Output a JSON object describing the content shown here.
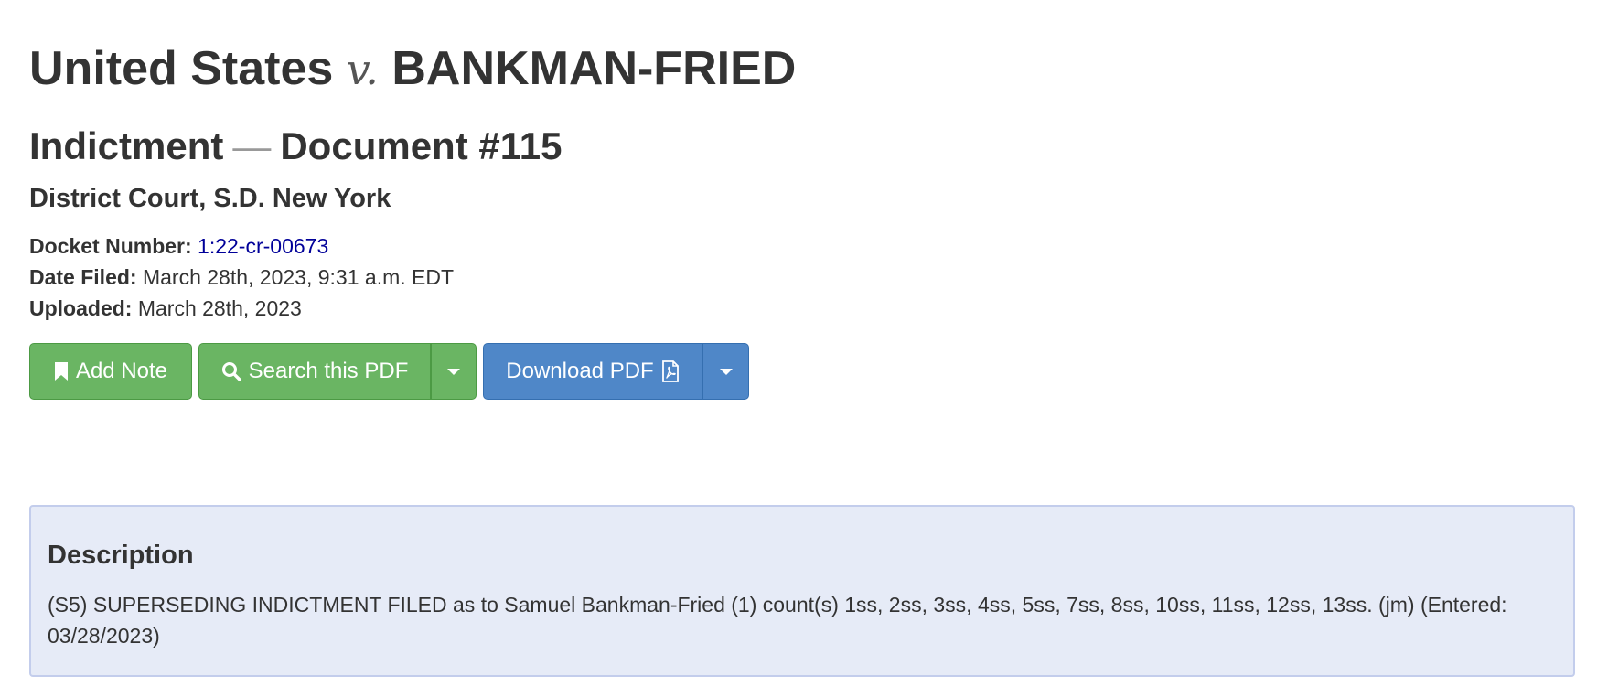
{
  "case": {
    "plaintiff": "United States",
    "versus": "v.",
    "defendant": "BANKMAN-FRIED"
  },
  "document": {
    "type": "Indictment",
    "separator": "—",
    "number": "Document #115"
  },
  "court": "District Court, S.D. New York",
  "meta": {
    "docket_label": "Docket Number:",
    "docket_value": "1:22-cr-00673",
    "filed_label": "Date Filed:",
    "filed_value": "March 28th, 2023, 9:31 a.m. EDT",
    "uploaded_label": "Uploaded:",
    "uploaded_value": "March 28th, 2023"
  },
  "actions": {
    "add_note": {
      "label": "Add Note",
      "icon": "bookmark-icon"
    },
    "search_pdf": {
      "label": "Search this PDF",
      "icon": "search-icon"
    },
    "search_dropdown": {
      "icon": "caret-down-icon"
    },
    "download_pdf": {
      "label": "Download PDF",
      "icon": "file-pdf-icon"
    },
    "download_dropdown": {
      "icon": "caret-down-icon"
    }
  },
  "description": {
    "heading": "Description",
    "text": "(S5) SUPERSEDING INDICTMENT FILED as to Samuel Bankman-Fried (1) count(s) 1ss, 2ss, 3ss, 4ss, 5ss, 7ss, 8ss, 10ss, 11ss, 12ss, 13ss. (jm) (Entered: 03/28/2023)"
  },
  "colors": {
    "success": "#6ab563",
    "primary": "#4f87c8",
    "link": "#000099",
    "panel_bg": "#e6ebf7",
    "panel_border": "#c3cdec"
  }
}
